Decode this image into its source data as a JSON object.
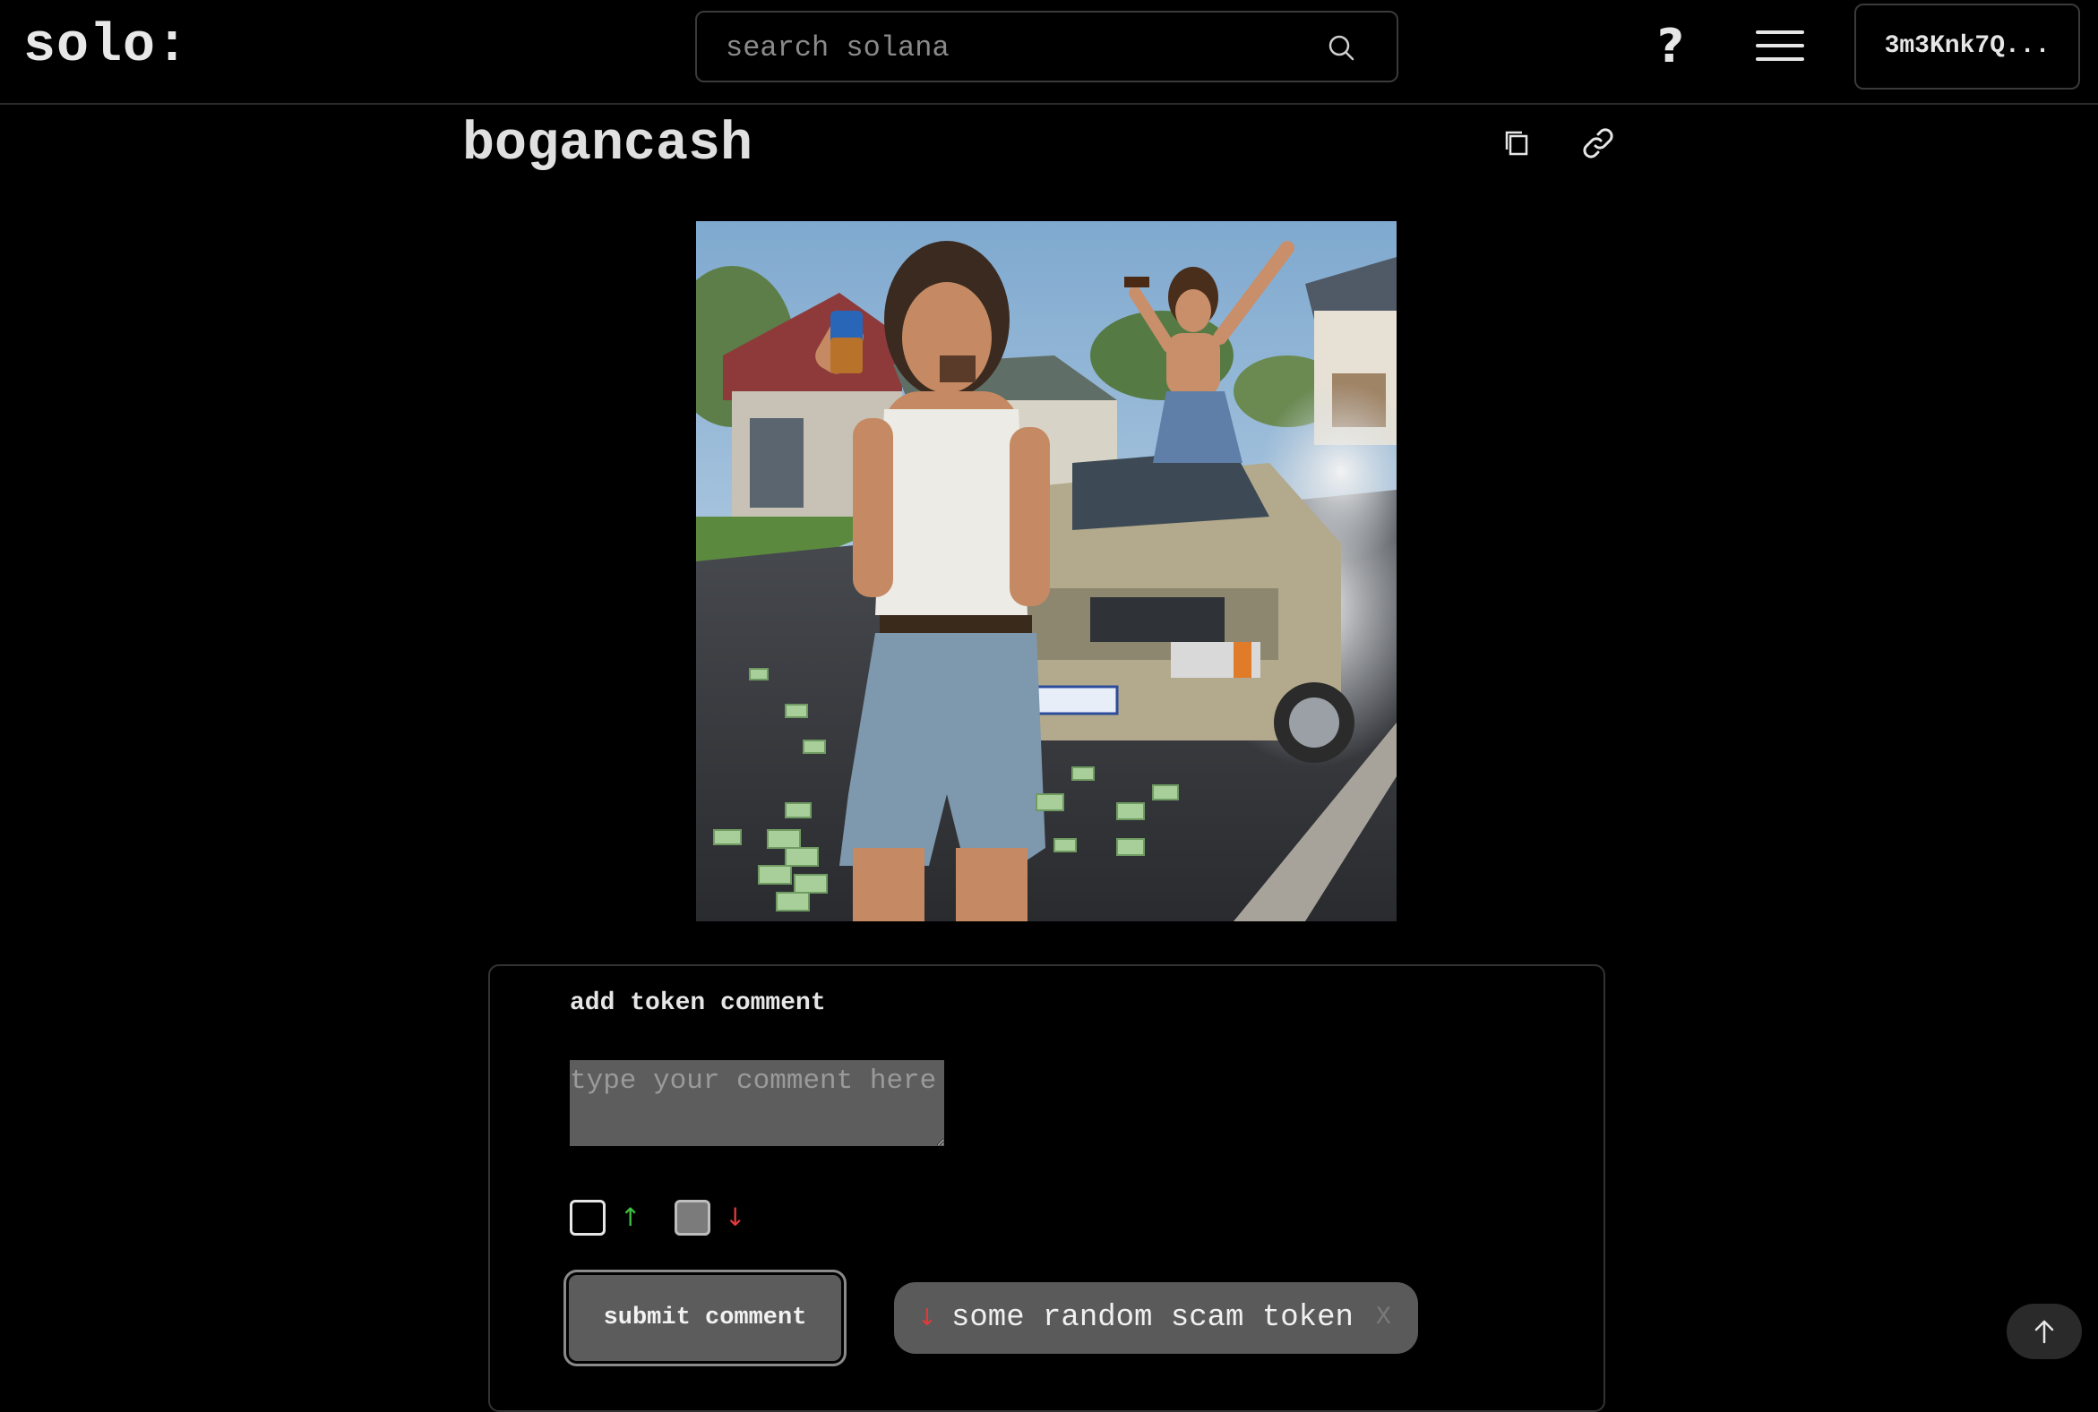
{
  "header": {
    "logo": "solo:",
    "search_placeholder": "search solana",
    "help_icon": "question-mark-icon",
    "menu_icon": "hamburger-menu-icon",
    "wallet_label": "3m3Knk7Q..."
  },
  "token": {
    "title": "bogancash",
    "copy_icon": "copy-icon",
    "link_icon": "link-icon",
    "image_icon": "token-artwork-image"
  },
  "comment_form": {
    "heading": "add token comment",
    "comment_placeholder": "type your comment here",
    "upvote_arrow": "↑",
    "downvote_arrow": "↓",
    "upvote_checked": false,
    "downvote_checked": true,
    "submit_label": "submit comment",
    "tag": {
      "arrow": "↓",
      "label": "some random scam token",
      "remove": "X"
    }
  },
  "colors": {
    "background": "#000000",
    "up_arrow": "#3fbf3f",
    "down_arrow": "#e03a3a",
    "chip_bg": "#5a5a5a",
    "button_bg": "#5c5c5c"
  },
  "scroll_top_icon": "arrow-up-icon"
}
